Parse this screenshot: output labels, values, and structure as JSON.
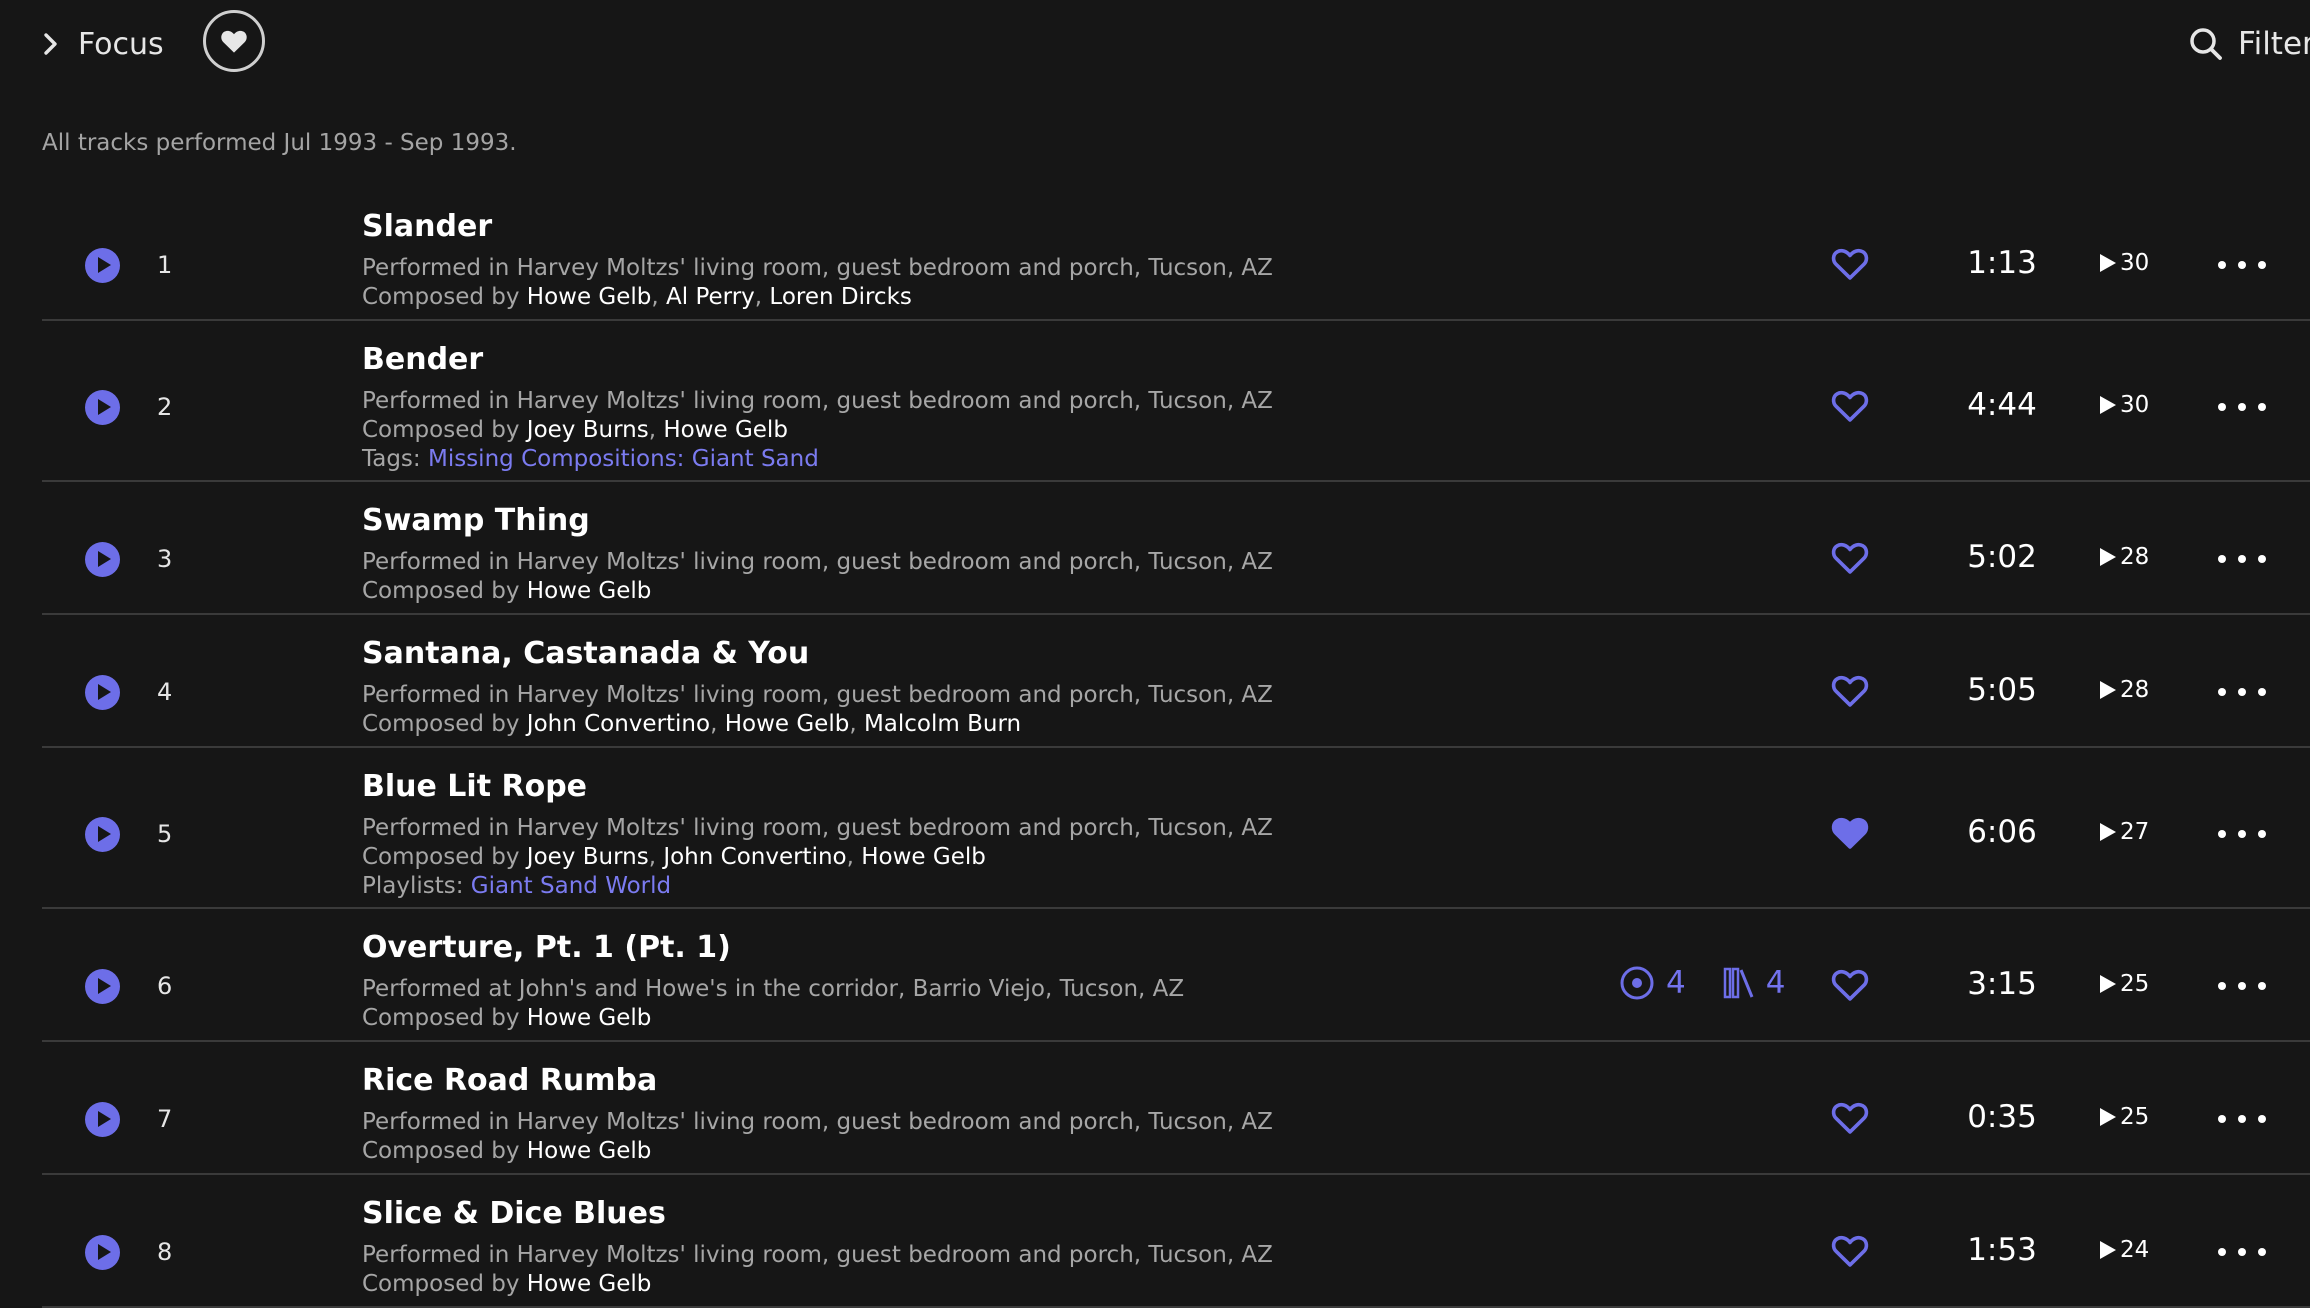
{
  "header": {
    "focus_label": "Focus",
    "filter_label": "Filter"
  },
  "summary": "All tracks performed Jul 1993 - Sep 1993.",
  "colors": {
    "background": "#161616",
    "accent": "#6d6ee8",
    "muted_text": "#a6a6a6",
    "divider": "#3a3a3a"
  },
  "labels": {
    "composed_by": "Composed by",
    "tags": "Tags:",
    "playlists": "Playlists:"
  },
  "tracks": [
    {
      "number": "1",
      "title": "Slander",
      "venue": "Performed in Harvey Moltzs' living room, guest bedroom and porch, Tucson, AZ",
      "composers": [
        "Howe Gelb",
        "Al Perry",
        "Loren Dircks"
      ],
      "favorited": false,
      "duration": "1:13",
      "plays": "30"
    },
    {
      "number": "2",
      "title": "Bender",
      "venue": "Performed in Harvey Moltzs' living room, guest bedroom and porch, Tucson, AZ",
      "composers": [
        "Joey Burns",
        "Howe Gelb"
      ],
      "tags": [
        "Missing Compositions: Giant Sand"
      ],
      "favorited": false,
      "duration": "4:44",
      "plays": "30"
    },
    {
      "number": "3",
      "title": "Swamp Thing",
      "venue": "Performed in Harvey Moltzs' living room, guest bedroom and porch, Tucson, AZ",
      "composers": [
        "Howe Gelb"
      ],
      "favorited": false,
      "duration": "5:02",
      "plays": "28"
    },
    {
      "number": "4",
      "title": "Santana, Castanada & You",
      "venue": "Performed in Harvey Moltzs' living room, guest bedroom and porch, Tucson, AZ",
      "composers": [
        "John Convertino",
        "Howe Gelb",
        "Malcolm Burn"
      ],
      "favorited": false,
      "duration": "5:05",
      "plays": "28"
    },
    {
      "number": "5",
      "title": "Blue Lit Rope",
      "venue": "Performed in Harvey Moltzs' living room, guest bedroom and porch, Tucson, AZ",
      "composers": [
        "Joey Burns",
        "John Convertino",
        "Howe Gelb"
      ],
      "playlists": [
        "Giant Sand World"
      ],
      "favorited": true,
      "duration": "6:06",
      "plays": "27"
    },
    {
      "number": "6",
      "title": "Overture, Pt. 1 (Pt. 1)",
      "venue": "Performed at John's and Howe's in the corridor, Barrio Viejo, Tucson, AZ",
      "composers": [
        "Howe Gelb"
      ],
      "versions_count": "4",
      "library_count": "4",
      "favorited": false,
      "duration": "3:15",
      "plays": "25"
    },
    {
      "number": "7",
      "title": "Rice Road Rumba",
      "venue": "Performed in Harvey Moltzs' living room, guest bedroom and porch, Tucson, AZ",
      "composers": [
        "Howe Gelb"
      ],
      "favorited": false,
      "duration": "0:35",
      "plays": "25"
    },
    {
      "number": "8",
      "title": "Slice & Dice Blues",
      "venue": "Performed in Harvey Moltzs' living room, guest bedroom and porch, Tucson, AZ",
      "composers": [
        "Howe Gelb"
      ],
      "favorited": false,
      "duration": "1:53",
      "plays": "24"
    }
  ]
}
